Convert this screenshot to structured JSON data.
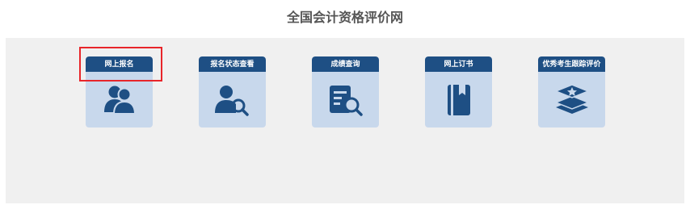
{
  "header": {
    "title": "全国会计资格评价网"
  },
  "cards": [
    {
      "label": "网上报名",
      "icon": "users-icon"
    },
    {
      "label": "报名状态查看",
      "icon": "user-search-icon"
    },
    {
      "label": "成绩查询",
      "icon": "document-search-icon"
    },
    {
      "label": "网上订书",
      "icon": "book-icon"
    },
    {
      "label": "优秀考生跟踪评价",
      "icon": "star-stack-icon"
    }
  ],
  "colors": {
    "card_header": "#1e4f84",
    "card_body": "#c8d8ec",
    "icon": "#1e4f84",
    "panel_background": "#f0f0f0",
    "highlight_border": "#e8252a"
  }
}
